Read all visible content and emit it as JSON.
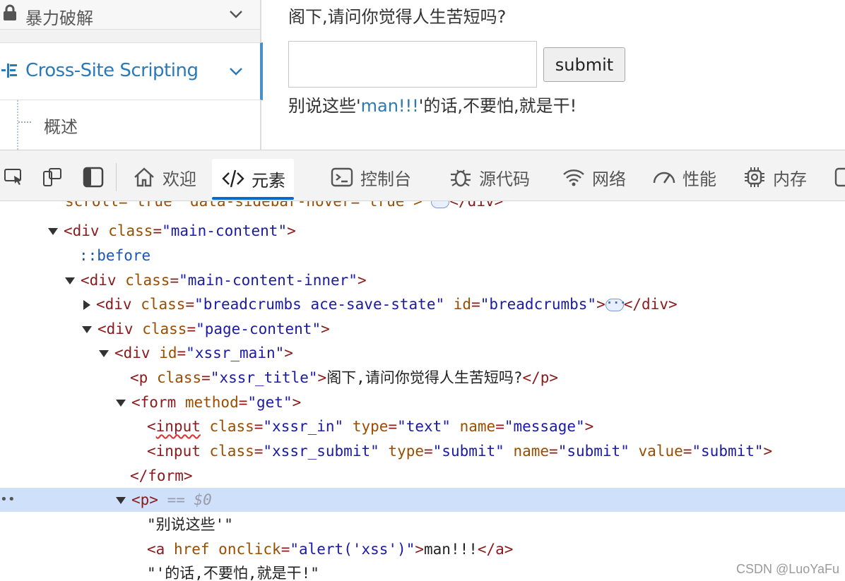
{
  "sidebar": {
    "items": [
      {
        "label": "暴力破解",
        "icon": "lock-icon"
      },
      {
        "label": "Cross-Site Scripting",
        "icon": "list-icon"
      },
      {
        "label": "概述"
      }
    ]
  },
  "xssr": {
    "title": "阁下,请问你觉得人生苦短吗?",
    "input_value": "",
    "submit_label": "submit",
    "msg_pre": "别说这些'",
    "msg_link": "man!!!",
    "msg_post": "'的话,不要怕,就是干!"
  },
  "devtools": {
    "tabs": [
      {
        "label": "欢迎",
        "icon": "home-icon"
      },
      {
        "label": "元素",
        "icon": "code-icon"
      },
      {
        "label": "控制台",
        "icon": "console-icon"
      },
      {
        "label": "源代码",
        "icon": "bug-icon"
      },
      {
        "label": "网络",
        "icon": "wifi-icon"
      },
      {
        "label": "性能",
        "icon": "gauge-icon"
      },
      {
        "label": "内存",
        "icon": "chip-icon"
      }
    ],
    "active_tab": "元素",
    "dom": {
      "cut_line": "scroll=\"true\" data-sidebar-hover=\"true\">",
      "l1_attr_name": "class",
      "l1_attr_val": "\"main-content\"",
      "l2_pseudo": "::before",
      "l3_attr_name": "class",
      "l3_attr_val": "\"main-content-inner\"",
      "l4_attr_name": "class",
      "l4_attr_val": "\"breadcrumbs ace-save-state\"",
      "l4_id_name": "id",
      "l4_id_val": "\"breadcrumbs\"",
      "l5_attr_name": "class",
      "l5_attr_val": "\"page-content\"",
      "l6_id_name": "id",
      "l6_id_val": "\"xssr_main\"",
      "l7_attr_name": "class",
      "l7_attr_val": "\"xssr_title\"",
      "l7_text": "阁下,请问你觉得人生苦短吗?",
      "l8_attr_name": "method",
      "l8_attr_val": "\"get\"",
      "l9_attrs": [
        "class",
        "\"xssr_in\"",
        "type",
        "\"text\"",
        "name",
        "\"message\""
      ],
      "l10_attrs": [
        "class",
        "\"xssr_submit\"",
        "type",
        "\"submit\"",
        "name",
        "\"submit\"",
        "value",
        "\"submit\""
      ],
      "sel_marker": "== $0",
      "text1": "\"别说这些'\"",
      "a_href": "href",
      "a_onclick": "onclick",
      "a_onclick_val": "\"alert('xss')\"",
      "a_text": "man!!!",
      "text2": "\"'的话,不要怕,就是干!\""
    }
  },
  "watermark": "CSDN @LuoYaFu",
  "colors": {
    "link": "#2a7ab8",
    "active_tab_underline": "#0a6ac9",
    "selected_row": "#cfe0fb"
  }
}
